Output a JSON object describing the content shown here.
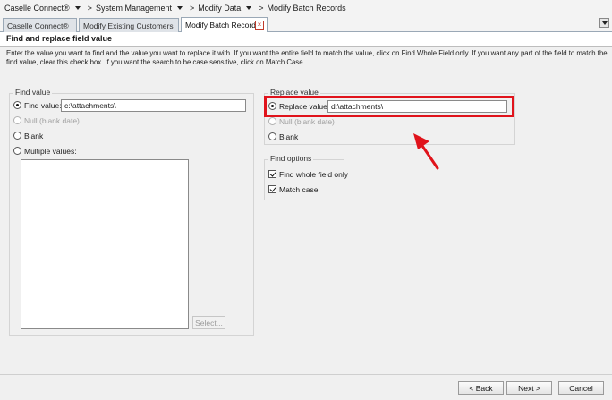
{
  "breadcrumb": {
    "items": [
      "Caselle Connect®",
      "System Management",
      "Modify Data"
    ],
    "current": "Modify Batch Records",
    "separator": ">"
  },
  "tabs": [
    {
      "label": "Caselle Connect®",
      "active": false
    },
    {
      "label": "Modify Existing Customers",
      "active": false
    },
    {
      "label": "Modify Batch Records",
      "active": true
    }
  ],
  "header": {
    "title": "Find and replace field value"
  },
  "description": "Enter the value you want to find and the value you want to replace it with.  If you want the entire field to match the value, click on Find Whole Field only.  If you want any part of the field to match the find value, clear this check box.  If you want the search to be case sensitive, click on Match Case.",
  "find": {
    "group_label": "Find value",
    "find_value_label": "Find value:",
    "find_value": "c:\\attachments\\",
    "null_label": "Null (blank date)",
    "blank_label": "Blank",
    "multiple_label": "Multiple values:",
    "select_button": "Select..."
  },
  "replace": {
    "group_label": "Replace value",
    "replace_value_label": "Replace value:",
    "replace_value": "d:\\attachments\\",
    "null_label": "Null (blank date)",
    "blank_label": "Blank"
  },
  "options": {
    "group_label": "Find options",
    "whole_field_label": "Find whole field only",
    "whole_field_checked": true,
    "match_case_label": "Match case",
    "match_case_checked": true
  },
  "buttons": {
    "back": "< Back",
    "next": "Next >",
    "cancel": "Cancel"
  },
  "colors": {
    "highlight": "#e0131b",
    "arrow": "#e0131b"
  },
  "icons": {
    "tab_close": "close-icon",
    "tab_dropdown": "chevron-down-icon",
    "annotation_arrow": "arrow-icon"
  }
}
